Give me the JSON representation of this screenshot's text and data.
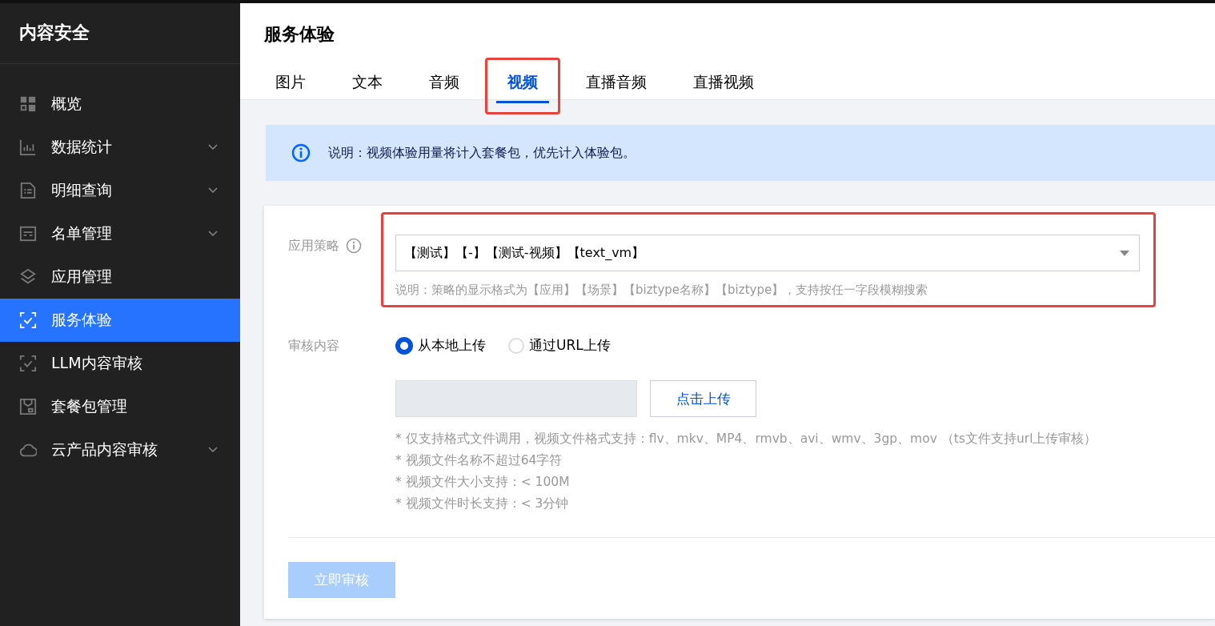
{
  "sidebar": {
    "title": "内容安全",
    "items": [
      {
        "label": "概览",
        "kind": "grid",
        "selected": false,
        "expandable": false
      },
      {
        "label": "数据统计",
        "kind": "bars",
        "selected": false,
        "expandable": true
      },
      {
        "label": "明细查询",
        "kind": "doc",
        "selected": false,
        "expandable": true
      },
      {
        "label": "名单管理",
        "kind": "list",
        "selected": false,
        "expandable": true
      },
      {
        "label": "应用管理",
        "kind": "layers",
        "selected": false,
        "expandable": false
      },
      {
        "label": "服务体验",
        "kind": "scan",
        "selected": true,
        "expandable": false
      },
      {
        "label": "LLM内容审核",
        "kind": "scan",
        "selected": false,
        "expandable": false
      },
      {
        "label": "套餐包管理",
        "kind": "package",
        "selected": false,
        "expandable": false
      },
      {
        "label": "云产品内容审核",
        "kind": "cloud",
        "selected": false,
        "expandable": true
      }
    ]
  },
  "page": {
    "title": "服务体验",
    "tabs": [
      {
        "label": "图片",
        "selected": false,
        "highlighted": false
      },
      {
        "label": "文本",
        "selected": false,
        "highlighted": false
      },
      {
        "label": "音频",
        "selected": false,
        "highlighted": false
      },
      {
        "label": "视频",
        "selected": true,
        "highlighted": true
      },
      {
        "label": "直播音频",
        "selected": false,
        "highlighted": false
      },
      {
        "label": "直播视频",
        "selected": false,
        "highlighted": false
      }
    ]
  },
  "notice": {
    "text": "说明：视频体验用量将计入套餐包，优先计入体验包。"
  },
  "form": {
    "strategy": {
      "label": "应用策略",
      "value": "【测试】【-】【测试-视频】【text_vm】",
      "hint": "说明：策略的显示格式为【应用】【场景】【biztype名称】【biztype】，支持按任一字段模糊搜索",
      "highlighted": true
    },
    "content": {
      "label": "审核内容",
      "options": [
        {
          "label": "从本地上传",
          "selected": true
        },
        {
          "label": "通过URL上传",
          "selected": false
        }
      ],
      "upload_button": "点击上传",
      "notes": [
        "* 仅支持格式文件调用，视频文件格式支持：flv、mkv、MP4、rmvb、avi、wmv、3gp、mov （ts文件支持url上传审核）",
        "* 视频文件名称不超过64字符",
        "* 视频文件大小支持：< 100M",
        "* 视频文件时长支持：< 3分钟"
      ]
    },
    "submit": {
      "label": "立即审核",
      "disabled": true
    }
  }
}
